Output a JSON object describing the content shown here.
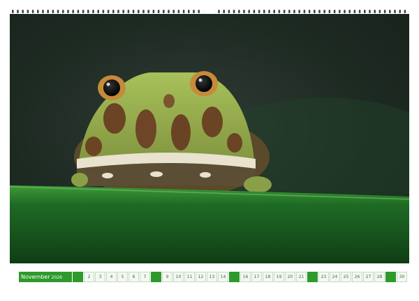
{
  "calendar": {
    "month": "November",
    "year": "2026",
    "days": [
      {
        "n": "1",
        "style": "wk"
      },
      {
        "n": "2",
        "style": "lt"
      },
      {
        "n": "3",
        "style": "lt"
      },
      {
        "n": "4",
        "style": "lt"
      },
      {
        "n": "5",
        "style": "lt"
      },
      {
        "n": "6",
        "style": "lt"
      },
      {
        "n": "7",
        "style": "lt"
      },
      {
        "n": "8",
        "style": "wk"
      },
      {
        "n": "9",
        "style": "lt"
      },
      {
        "n": "10",
        "style": "lt"
      },
      {
        "n": "11",
        "style": "lt"
      },
      {
        "n": "12",
        "style": "lt"
      },
      {
        "n": "13",
        "style": "lt"
      },
      {
        "n": "14",
        "style": "lt"
      },
      {
        "n": "15",
        "style": "wk"
      },
      {
        "n": "16",
        "style": "lt"
      },
      {
        "n": "17",
        "style": "lt"
      },
      {
        "n": "18",
        "style": "lt"
      },
      {
        "n": "19",
        "style": "lt"
      },
      {
        "n": "20",
        "style": "lt"
      },
      {
        "n": "21",
        "style": "lt"
      },
      {
        "n": "22",
        "style": "wk"
      },
      {
        "n": "23",
        "style": "lt"
      },
      {
        "n": "24",
        "style": "lt"
      },
      {
        "n": "25",
        "style": "lt"
      },
      {
        "n": "26",
        "style": "lt"
      },
      {
        "n": "27",
        "style": "lt"
      },
      {
        "n": "28",
        "style": "lt"
      },
      {
        "n": "29",
        "style": "wk"
      },
      {
        "n": "30",
        "style": "lt"
      }
    ]
  },
  "colors": {
    "accent": "#2e9a2c"
  }
}
